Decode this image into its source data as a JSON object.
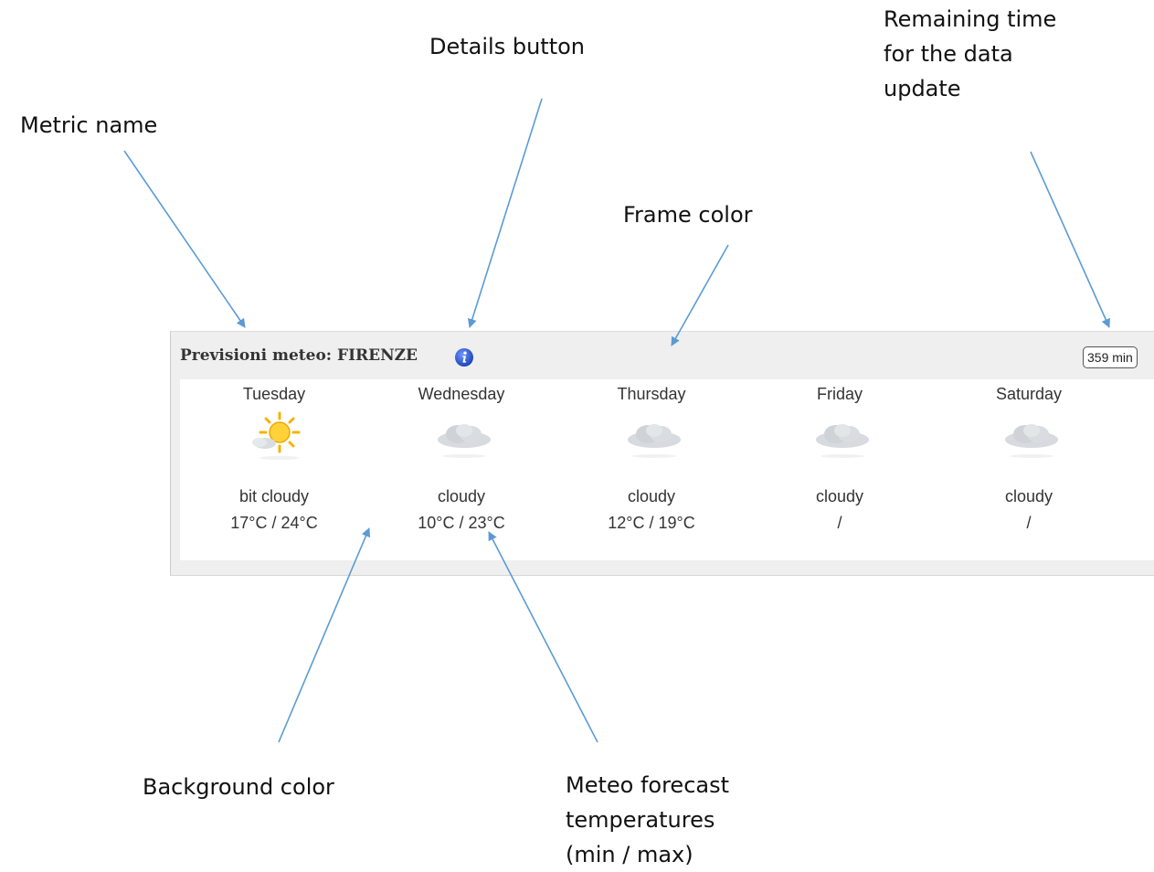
{
  "callouts": {
    "metric_name": "Metric name",
    "details_button": "Details button",
    "remaining_time": "Remaining time\nfor the data\nupdate",
    "frame_color": "Frame color",
    "background_color": "Background color",
    "forecast_temps": "Meteo forecast\ntemperatures\n(min / max)"
  },
  "widget": {
    "title": "Previsioni meteo: FIRENZE",
    "info_icon": "info-icon",
    "update_badge": "359 min",
    "colors": {
      "frame": "#efefef",
      "background": "#ffffff",
      "arrow": "#5b9bd5",
      "info_icon": "#2a5fd6"
    },
    "days": [
      {
        "name": "Tuesday",
        "icon": "sun-cloud-icon",
        "condition": "bit cloudy",
        "temps": "17°C / 24°C"
      },
      {
        "name": "Wednesday",
        "icon": "cloud-icon",
        "condition": "cloudy",
        "temps": "10°C / 23°C"
      },
      {
        "name": "Thursday",
        "icon": "cloud-icon",
        "condition": "cloudy",
        "temps": "12°C / 19°C"
      },
      {
        "name": "Friday",
        "icon": "cloud-icon",
        "condition": "cloudy",
        "temps": "/"
      },
      {
        "name": "Saturday",
        "icon": "cloud-icon",
        "condition": "cloudy",
        "temps": "/"
      }
    ]
  }
}
